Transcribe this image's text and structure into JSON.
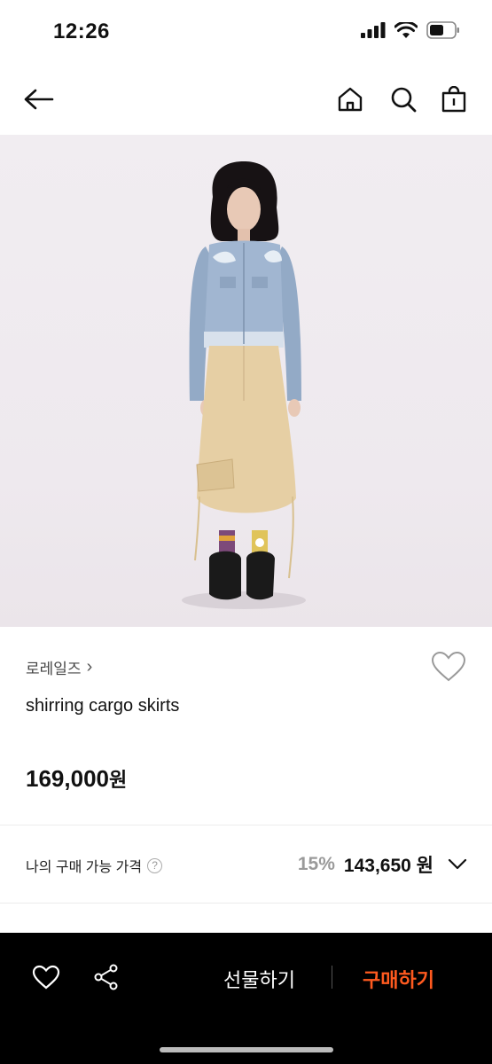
{
  "status_bar": {
    "time": "12:26"
  },
  "product": {
    "brand": "로레일즈",
    "brand_chevron": "›",
    "name": "shirring cargo skirts",
    "price": "169,000",
    "currency": "원"
  },
  "my_price": {
    "label": "나의 구매 가능 가격",
    "help": "?",
    "discount": "15%",
    "price": "143,650",
    "currency": "원"
  },
  "bottom_bar": {
    "gift_label": "선물하기",
    "buy_label": "구매하기"
  },
  "colors": {
    "accent": "#ff5a1f",
    "bottom_bar_bg": "#000000"
  },
  "icons": [
    "back-arrow-icon",
    "home-icon",
    "search-icon",
    "shopping-bag-icon",
    "heart-outline-icon",
    "share-icon",
    "chevron-down-icon"
  ]
}
